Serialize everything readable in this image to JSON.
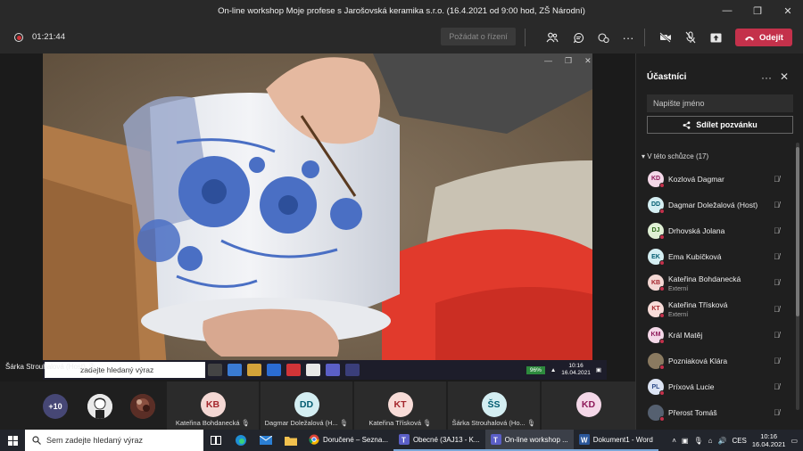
{
  "window": {
    "title": "On-line workshop Moje profese s Jarošovská keramika s.r.o. (16.4.2021 od 9:00 hod, ZŠ Národní)",
    "minimize": "—",
    "maximize": "❐",
    "close": "✕"
  },
  "toolbar": {
    "timer": "01:21:44",
    "request_control": "Požádat o řízení",
    "leave_label": "Odejít"
  },
  "stage": {
    "presenter": "Šárka Strouhalová (Host)",
    "inner_search": "zadejte hledaný výraz",
    "inner_battery": "96%",
    "inner_time": "10:16",
    "inner_date": "16.04.2021"
  },
  "strip": {
    "more": "+10",
    "tiles": [
      {
        "initials": "KB",
        "name": "Kateřina Bohdanecká",
        "bg": "#f4d8d4",
        "fg": "#a4262c"
      },
      {
        "initials": "DD",
        "name": "Dagmar Doležalová (H...",
        "bg": "#d4eef2",
        "fg": "#005b70"
      },
      {
        "initials": "KT",
        "name": "Kateřina Třísková",
        "bg": "#f8dcd8",
        "fg": "#a4262c"
      },
      {
        "initials": "ŠS",
        "name": "Šárka Strouhalová (Ho...",
        "bg": "#d4eef2",
        "fg": "#005b70"
      },
      {
        "initials": "KD",
        "name": "",
        "bg": "#f4d8e8",
        "fg": "#8e1a5a"
      }
    ]
  },
  "panel": {
    "title": "Účastníci",
    "search_placeholder": "Napište jméno",
    "share_label": "Sdílet pozvánku",
    "section": "V této schůzce (17)",
    "participants": [
      {
        "initials": "KD",
        "name": "Kozlová Dagmar",
        "sub": "",
        "bg": "#f4d8e8",
        "fg": "#8e1a5a"
      },
      {
        "initials": "DD",
        "name": "Dagmar Doležalová (Host)",
        "sub": "",
        "bg": "#d4eef2",
        "fg": "#005b70"
      },
      {
        "initials": "DJ",
        "name": "Drhovská Jolana",
        "sub": "",
        "bg": "#dff0d4",
        "fg": "#2d6a1a"
      },
      {
        "initials": "EK",
        "name": "Ema Kubíčková",
        "sub": "",
        "bg": "#d4eef2",
        "fg": "#005b70"
      },
      {
        "initials": "KB",
        "name": "Kateřina Bohdanecká",
        "sub": "Externí",
        "bg": "#f4d8d4",
        "fg": "#a4262c"
      },
      {
        "initials": "KT",
        "name": "Kateřina Třísková",
        "sub": "Externí",
        "bg": "#f8dcd8",
        "fg": "#a4262c"
      },
      {
        "initials": "KM",
        "name": "Král Matěj",
        "sub": "",
        "bg": "#f4d8e8",
        "fg": "#8e1a5a"
      },
      {
        "initials": "",
        "name": "Pozniaková Klára",
        "sub": "",
        "bg": "#8a7a60",
        "fg": "#fff"
      },
      {
        "initials": "PL",
        "name": "Príxová Lucie",
        "sub": "",
        "bg": "#dce4f4",
        "fg": "#2b4a8a"
      },
      {
        "initials": "",
        "name": "Přerost Tomáš",
        "sub": "",
        "bg": "#556070",
        "fg": "#fff"
      }
    ]
  },
  "taskbar": {
    "search": "Sem zadejte hledaný výraz",
    "apps": [
      {
        "label": "Doručené – Sezna...",
        "color": "#e84a3a"
      },
      {
        "label": "Obecné (3AJ13 - K...",
        "color": "#5b5fc7"
      },
      {
        "label": "On-line workshop ...",
        "color": "#5b5fc7"
      },
      {
        "label": "Dokument1 - Word",
        "color": "#2b579a"
      }
    ],
    "lang": "CES",
    "time": "10:16",
    "date": "16.04.2021"
  }
}
